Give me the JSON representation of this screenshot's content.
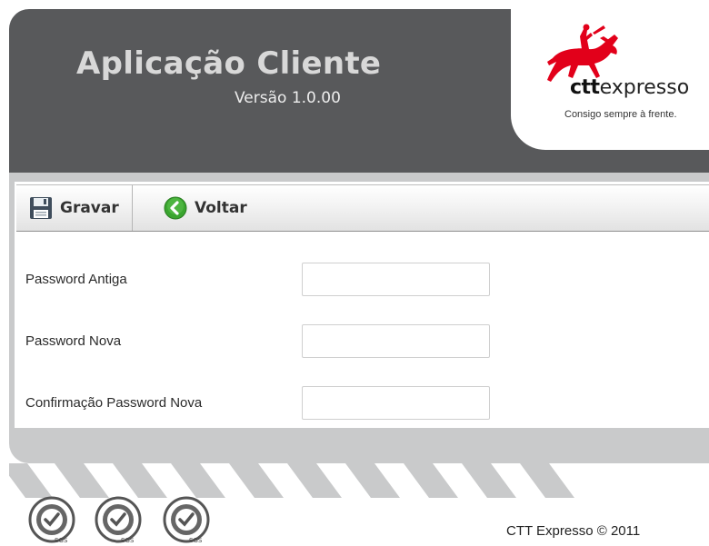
{
  "header": {
    "app_title": "Aplicação Cliente",
    "version": "Versão 1.0.00",
    "background_color": "#58595b"
  },
  "logo": {
    "brand_bold": "ctt",
    "brand_rest": "expresso",
    "slogan": "Consigo sempre à frente.",
    "icon": "horse-rider-icon",
    "accent_color": "#e2001a"
  },
  "toolbar": {
    "save_label": "Gravar",
    "save_icon": "floppy-disk-icon",
    "back_label": "Voltar",
    "back_icon": "green-back-arrow-icon",
    "back_color": "#3aa52f"
  },
  "form": {
    "old_password_label": "Password Antiga",
    "old_password_value": "",
    "new_password_label": "Password Nova",
    "new_password_value": "",
    "confirm_password_label": "Confirmação Password Nova",
    "confirm_password_value": ""
  },
  "footer": {
    "copyright": "CTT Expresso © 2011",
    "cert_label": "SGS",
    "cert_icon": "sgs-certification-icon"
  }
}
